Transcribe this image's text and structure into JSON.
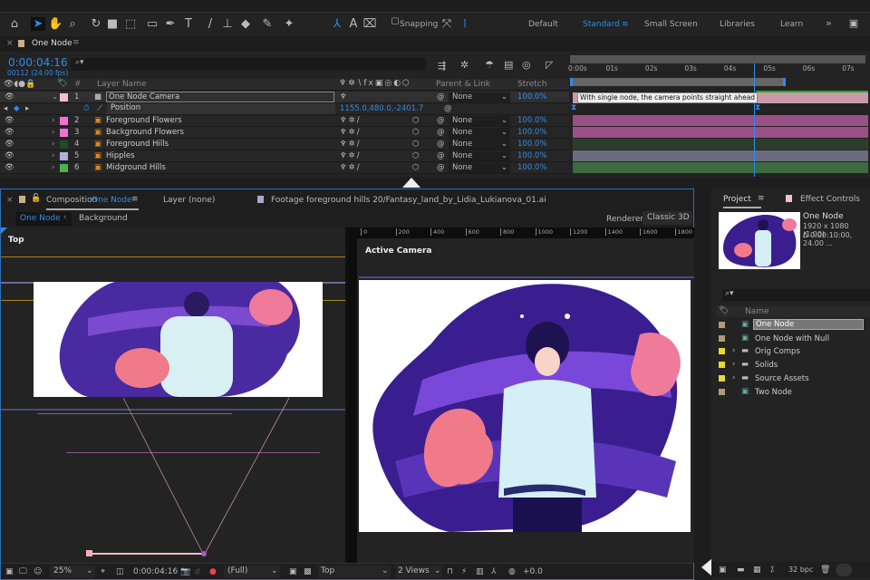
{
  "toolbar": {
    "snapping": "Snapping",
    "workspaces": [
      "Default",
      "Standard",
      "Small Screen",
      "Libraries",
      "Learn"
    ],
    "active_workspace": "Standard",
    "more": "»"
  },
  "timeline": {
    "tab_close": "×",
    "tab_title": "One Node",
    "timecode": "0:00:04:16",
    "frames": "00112 (24.00 fps)",
    "search_placeholder": "",
    "headers": {
      "layer_name": "Layer Name",
      "num": "#",
      "parent": "Parent & Link",
      "stretch": "Stretch"
    },
    "ruler": [
      "0:00s",
      "01s",
      "02s",
      "03s",
      "04s",
      "05s",
      "06s",
      "07s"
    ],
    "marker_comment": "With single node, the camera points straight ahead",
    "layers": [
      {
        "num": "1",
        "name": "One Node Camera",
        "color": "#f0c0d0",
        "parent": "None",
        "stretch": "100.0%",
        "bar": "#c89aaa"
      },
      {
        "num": "2",
        "name": "Foreground Flowers",
        "color": "#f070d8",
        "parent": "None",
        "stretch": "100.0%",
        "bar": "#9a4f86"
      },
      {
        "num": "3",
        "name": "Background Flowers",
        "color": "#f070d8",
        "parent": "None",
        "stretch": "100.0%",
        "bar": "#9a4f86"
      },
      {
        "num": "4",
        "name": "Foreground Hills",
        "color": "#1f4a22",
        "parent": "None",
        "stretch": "100.0%",
        "bar": "#2c3d2c"
      },
      {
        "num": "5",
        "name": "Hipples",
        "color": "#b0b0d8",
        "parent": "None",
        "stretch": "100.0%",
        "bar": "#6b6a7e"
      },
      {
        "num": "6",
        "name": "Midground Hills",
        "color": "#4caf50",
        "parent": "None",
        "stretch": "100.0%",
        "bar": "#3d6a3f"
      }
    ],
    "position": {
      "label": "Position",
      "value": "1155.0,480.0,-2401.7"
    },
    "playhead_seconds": 4.67,
    "duration_seconds": 7.5
  },
  "composition": {
    "close": "×",
    "title_prefix": "Composition",
    "title_name": "One Node",
    "layer_tab": "Layer (none)",
    "footage_tab": "Footage foreground hills 20/Fantasy_land_by_Lidia_Lukianova_01.ai",
    "breadcrumb": [
      "One Node",
      "Background"
    ],
    "renderer_label": "Renderer:",
    "renderer": "Classic 3D",
    "left_view": "Top",
    "right_view": "Active Camera",
    "ruler": [
      "0",
      "200",
      "400",
      "600",
      "800",
      "1000",
      "1200",
      "1400",
      "1600",
      "1800"
    ],
    "bottom": {
      "zoom": "25%",
      "timecode": "0:00:04:16",
      "resolution": "(Full)",
      "view": "Top",
      "views": "2 Views",
      "exposure": "+0.0"
    }
  },
  "project": {
    "tab": "Project",
    "effect_tab": "Effect Controls",
    "selected_name": "One Node",
    "dims": "1920 x 1080 (1.00)",
    "duration": "Δ 0:00:10:00, 24.00 ...",
    "name_header": "Name",
    "items": [
      {
        "name": "One Node",
        "type": "comp",
        "color": "#b09a78"
      },
      {
        "name": "One Node with Null",
        "type": "comp",
        "color": "#b09a78"
      },
      {
        "name": "Orig Comps",
        "type": "folder",
        "color": "#e8d830"
      },
      {
        "name": "Solids",
        "type": "folder",
        "color": "#e8d830"
      },
      {
        "name": "Source Assets",
        "type": "folder",
        "color": "#e8d830"
      },
      {
        "name": "Two Node",
        "type": "comp",
        "color": "#b09a78"
      }
    ],
    "bpc": "32 bpc"
  }
}
